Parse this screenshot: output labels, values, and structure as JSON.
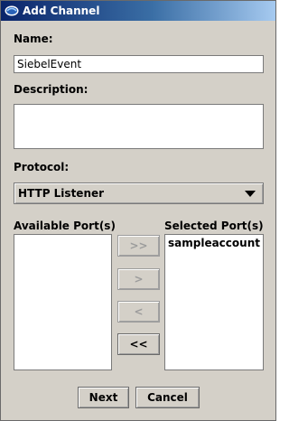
{
  "window": {
    "title": "Add Channel"
  },
  "form": {
    "name_label": "Name:",
    "name_value": "SiebelEvent",
    "description_label": "Description:",
    "description_value": "",
    "protocol_label": "Protocol:",
    "protocol_selected": "HTTP Listener"
  },
  "ports": {
    "available_label": "Available Port(s)",
    "selected_label": "Selected Port(s)",
    "available_items": [],
    "selected_items": [
      "sampleaccount"
    ],
    "buttons": {
      "add_all": ">>",
      "add": ">",
      "remove": "<",
      "remove_all": "<<"
    }
  },
  "footer": {
    "next_label": "Next",
    "cancel_label": "Cancel"
  },
  "colors": {
    "titlebar_start": "#0a246a",
    "titlebar_end": "#a6caf0",
    "window_bg": "#d4d0c8"
  }
}
